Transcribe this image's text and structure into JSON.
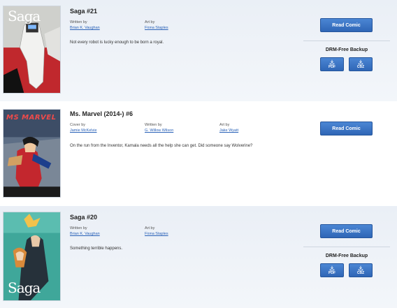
{
  "items": [
    {
      "title": "Saga #21",
      "credits": [
        {
          "role": "Written by",
          "name": "Brian K. Vaughan"
        },
        {
          "role": "Art by",
          "name": "Fiona Staples"
        }
      ],
      "description": "Not every robot is lucky enough to be born a royal.",
      "read_label": "Read Comic",
      "drm_title": "DRM-Free Backup",
      "downloads": [
        "PDF",
        "CBZ"
      ],
      "cover": {
        "logo": "Saga"
      }
    },
    {
      "title": "Ms. Marvel (2014-) #6",
      "credits": [
        {
          "role": "Cover by",
          "name": "Jamie McKelvie"
        },
        {
          "role": "Written by",
          "name": "G. Willow Wilson"
        },
        {
          "role": "Art by",
          "name": "Jake Wyatt"
        }
      ],
      "description": "On the run from the Inventor, Kamala needs all the help she can get. Did someone say Wolverine?",
      "read_label": "Read Comic",
      "cover": {
        "logo": "MS MARVEL"
      }
    },
    {
      "title": "Saga #20",
      "credits": [
        {
          "role": "Written by",
          "name": "Brian K. Vaughan"
        },
        {
          "role": "Art by",
          "name": "Fiona Staples"
        }
      ],
      "description": "Something terrible happens.",
      "read_label": "Read Comic",
      "drm_title": "DRM-Free Backup",
      "downloads": [
        "PDF",
        "CBZ"
      ],
      "cover": {
        "logo": "Saga"
      }
    }
  ],
  "colors": {
    "button": "#3a74c6",
    "link": "#2a62b8",
    "shade": "#eef2f8"
  },
  "icons": {
    "download": "download-arrow-icon"
  }
}
